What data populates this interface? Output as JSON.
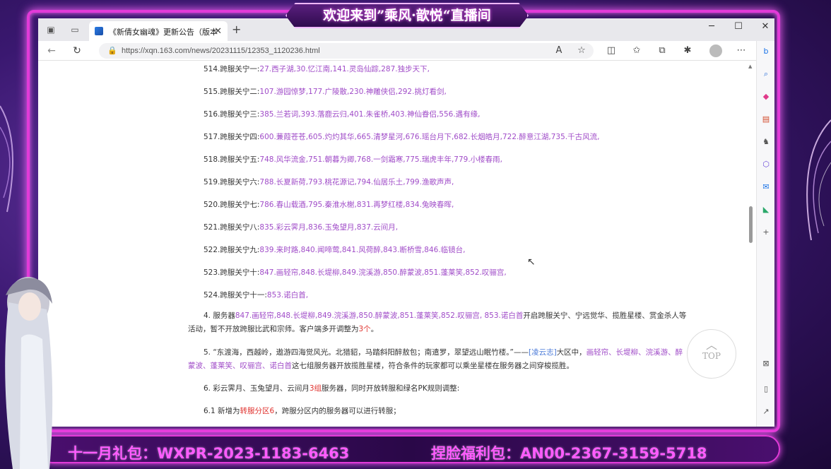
{
  "stream": {
    "banner_title": "欢迎来到”乘风·歆悦“直播间",
    "promo_left": "十一月礼包：WXPR-2023-1183-6463",
    "promo_right": "捏脸福利包：AN00-2367-3159-5718"
  },
  "browser": {
    "tab_title": "《新倩女幽魂》更新公告（版本",
    "url": "https://xqn.163.com/news/20231115/12353_1120236.html",
    "accent_color": "#1a73e8"
  },
  "article": {
    "server_lines": [
      {
        "label": "514.跨服关宁一:",
        "servers": "27.西子湖,30.忆江南,141.灵岛仙踪,287.独步天下,"
      },
      {
        "label": "515.跨服关宁二:",
        "servers": "107.游园惊梦,177.广陵散,230.神雕侠侣,292.挑灯看剑,"
      },
      {
        "label": "516.跨服关宁三:",
        "servers": "385.兰若词,393.落鹿云归,401.朱雀桥,403.神仙眷侣,556.遇有缘,"
      },
      {
        "label": "517.跨服关宁四:",
        "servers": "600.蒹葭苍苍,605.灼灼其华,665.清梦星河,676.瑶台月下,682.长烟皓月,722.醉意江湖,735.千古风流,"
      },
      {
        "label": "518.跨服关宁五:",
        "servers": "748.风华流金,751.朝暮为卿,768.一剑霜寒,775.瑞虎丰年,779.小楼春雨,"
      },
      {
        "label": "519.跨服关宁六:",
        "servers": "788.长夏新荷,793.桃花源记,794.仙居乐土,799.渔歌声声,"
      },
      {
        "label": "520.跨服关宁七:",
        "servers": "786.春山载酒,795.秦淮水榭,831.再梦红楼,834.兔映春晖,"
      },
      {
        "label": "521.跨服关宁八:",
        "servers": "835.彩云霁月,836.玉兔望月,837.云间月,"
      },
      {
        "label": "522.跨服关宁九:",
        "servers": "839.来时路,840.闻啼莺,841.风荷醉,843.断桥雪,846.临镜台,"
      },
      {
        "label": "523.跨服关宁十:",
        "servers": "847.画轻帘,848.长堤柳,849.浣溪游,850.醉蒙波,851.蓬莱笑,852.叹骊宫,"
      },
      {
        "label": "524.跨服关宁十一:",
        "servers": "853.诺白首,"
      }
    ],
    "p4_a": "4. 服务器",
    "p4_servers": "847.画轻帘,848.长堤柳,849.浣溪游,850.醉蒙波,851.蓬莱笑,852.叹骊宫, 853.诺白首",
    "p4_b": "开启跨服关宁、宁远觉华、揽胜星楼、赏金杀人等活动，暂不开放跨服比武和宗师。客户端多开调整为",
    "p4_count": "3个",
    "p4_end": "。",
    "p5_a": "5. “东渡海，西越岭，遨游四海觉风光。北猎貂，马踏斜阳醉敖包；南遣罗，翠望远山眠竹楼。”——",
    "p5_link": "[凌云志]",
    "p5_b": "大区中，",
    "p5_servers": "画轻帘、长堤柳、浣溪游、醉蒙波、蓬莱笑、叹骊宫、诺白首",
    "p5_c": "这七组服务器开放揽胜星楼，符合条件的玩家都可以乘坐星楼在服务器之间穿梭揽胜。",
    "p6_a": "6. 彩云霁月、玉兔望月、云间月",
    "p6_count": "3组",
    "p6_b": "服务器，同时开放转服和绿名PK规则调整:",
    "p61_a": "6.1 新增为",
    "p61_hl": "转服分区6",
    "p61_b": "，跨服分区内的服务器可以进行转服；",
    "top_label": "TOP"
  }
}
